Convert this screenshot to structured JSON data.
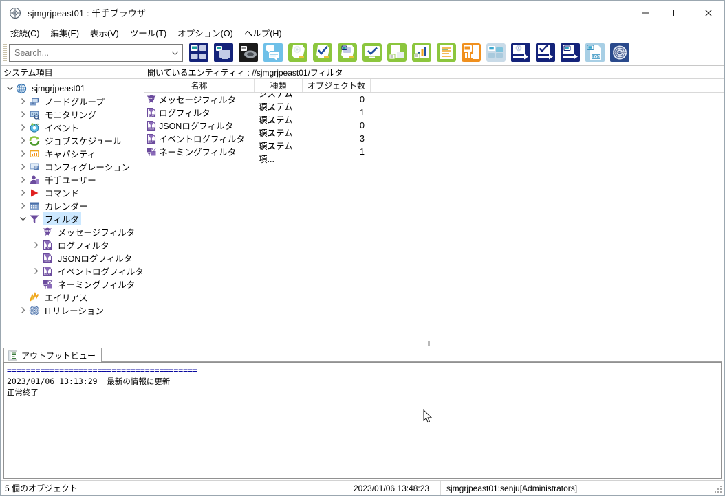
{
  "window": {
    "title": "sjmgrjpeast01 : 千手ブラウザ",
    "app_icon": "senju-app-icon",
    "controls": {
      "minimize": "—",
      "maximize": "☐",
      "close": "✕"
    }
  },
  "menubar": {
    "items": [
      {
        "label": "接続(C)",
        "name": "menu-connect"
      },
      {
        "label": "編集(E)",
        "name": "menu-edit"
      },
      {
        "label": "表示(V)",
        "name": "menu-view"
      },
      {
        "label": "ツール(T)",
        "name": "menu-tools"
      },
      {
        "label": "オプション(O)",
        "name": "menu-options"
      },
      {
        "label": "ヘルプ(H)",
        "name": "menu-help"
      }
    ]
  },
  "toolbar": {
    "search": {
      "value": "",
      "placeholder": "Search...",
      "chevron": "⌄"
    },
    "buttons": [
      {
        "name": "node-group-icon",
        "title": "ノードグループ"
      },
      {
        "name": "monitoring-icon",
        "title": "モニタリング"
      },
      {
        "name": "event-icon",
        "title": "イベント"
      },
      {
        "name": "message-filter-icon",
        "title": "メッセージフィルタ"
      },
      {
        "name": "job-schedule-icon",
        "title": "ジョブスケジュール"
      },
      {
        "name": "job-check-icon",
        "title": "ジョブ確認"
      },
      {
        "name": "job-monitor-icon",
        "title": "ジョブ監視"
      },
      {
        "name": "task-check-icon",
        "title": "タスク確認"
      },
      {
        "name": "report-doc-icon",
        "title": "レポート"
      },
      {
        "name": "capacity-chart-icon",
        "title": "キャパシティ"
      },
      {
        "name": "config-list-icon",
        "title": "コンフィグレーション"
      },
      {
        "name": "capacity-orange-icon",
        "title": "キャパシティ監視"
      },
      {
        "name": "it-relation-icon",
        "title": "ITリレーション"
      },
      {
        "name": "export-monitor-icon",
        "title": "エクスポート監視"
      },
      {
        "name": "export-check-icon",
        "title": "エクスポート確認"
      },
      {
        "name": "export-node-icon",
        "title": "エクスポートノード"
      },
      {
        "name": "log-file-icon",
        "title": "ログ"
      },
      {
        "name": "senju-target-icon",
        "title": "千手"
      }
    ]
  },
  "sidebar": {
    "header": "システム項目",
    "items": [
      {
        "label": "sjmgrjpeast01",
        "indent": 0,
        "expander": "down",
        "icon": "globe-icon",
        "selected": false,
        "name": "tree-item-root"
      },
      {
        "label": "ノードグループ",
        "indent": 1,
        "expander": "right",
        "icon": "node-group-icon",
        "selected": false,
        "name": "tree-item-node-group"
      },
      {
        "label": "モニタリング",
        "indent": 1,
        "expander": "right",
        "icon": "monitoring-icon",
        "selected": false,
        "name": "tree-item-monitoring"
      },
      {
        "label": "イベント",
        "indent": 1,
        "expander": "right",
        "icon": "event-icon",
        "selected": false,
        "name": "tree-item-event"
      },
      {
        "label": "ジョブスケジュール",
        "indent": 1,
        "expander": "right",
        "icon": "job-schedule-icon",
        "selected": false,
        "name": "tree-item-job-schedule"
      },
      {
        "label": "キャパシティ",
        "indent": 1,
        "expander": "right",
        "icon": "capacity-icon",
        "selected": false,
        "name": "tree-item-capacity"
      },
      {
        "label": "コンフィグレーション",
        "indent": 1,
        "expander": "right",
        "icon": "configuration-icon",
        "selected": false,
        "name": "tree-item-configuration"
      },
      {
        "label": "千手ユーザー",
        "indent": 1,
        "expander": "right",
        "icon": "user-icon",
        "selected": false,
        "name": "tree-item-senju-user"
      },
      {
        "label": "コマンド",
        "indent": 1,
        "expander": "right",
        "icon": "command-play-icon",
        "selected": false,
        "name": "tree-item-command"
      },
      {
        "label": "カレンダー",
        "indent": 1,
        "expander": "right",
        "icon": "calendar-icon",
        "selected": false,
        "name": "tree-item-calendar"
      },
      {
        "label": "フィルタ",
        "indent": 1,
        "expander": "down",
        "icon": "filter-icon",
        "selected": true,
        "name": "tree-item-filter"
      },
      {
        "label": "メッセージフィルタ",
        "indent": 2,
        "expander": "none",
        "icon": "message-filter-icon",
        "selected": false,
        "name": "tree-item-message-filter"
      },
      {
        "label": "ログフィルタ",
        "indent": 2,
        "expander": "right",
        "icon": "log-filter-icon",
        "selected": false,
        "name": "tree-item-log-filter"
      },
      {
        "label": "JSONログフィルタ",
        "indent": 2,
        "expander": "none",
        "icon": "json-log-filter-icon",
        "selected": false,
        "name": "tree-item-json-log-filter"
      },
      {
        "label": "イベントログフィルタ",
        "indent": 2,
        "expander": "right",
        "icon": "event-log-filter-icon",
        "selected": false,
        "name": "tree-item-event-log-filter"
      },
      {
        "label": "ネーミングフィルタ",
        "indent": 2,
        "expander": "none",
        "icon": "naming-filter-icon",
        "selected": false,
        "name": "tree-item-naming-filter"
      },
      {
        "label": "エイリアス",
        "indent": 1,
        "expander": "none",
        "icon": "alias-icon",
        "selected": false,
        "name": "tree-item-alias"
      },
      {
        "label": "ITリレーション",
        "indent": 1,
        "expander": "right",
        "icon": "it-relation-icon",
        "selected": false,
        "name": "tree-item-it-relation"
      }
    ]
  },
  "content": {
    "entity_bar": "開いているエンティティィ : //sjmgrjpeast01/フィルタ",
    "columns": [
      "名称",
      "種類",
      "オブジェクト数"
    ],
    "rows": [
      {
        "name": "メッセージフィルタ",
        "type": "システム項...",
        "count": "0",
        "icon": "message-filter-icon"
      },
      {
        "name": "ログフィルタ",
        "type": "システム項...",
        "count": "1",
        "icon": "log-filter-icon"
      },
      {
        "name": "JSONログフィルタ",
        "type": "システム項...",
        "count": "0",
        "icon": "json-log-filter-icon"
      },
      {
        "name": "イベントログフィルタ",
        "type": "システム項...",
        "count": "3",
        "icon": "event-log-filter-icon"
      },
      {
        "name": "ネーミングフィルタ",
        "type": "システム項...",
        "count": "1",
        "icon": "naming-filter-icon"
      }
    ]
  },
  "output": {
    "tab_label": "アウトプットビュー",
    "tab_icon": "output-view-icon",
    "separator_line": "========================================",
    "line1": "2023/01/06 13:13:29  最新の情報に更新",
    "line2": "正常終了"
  },
  "statusbar": {
    "objects": "5 個のオブジェクト",
    "timestamp": "2023/01/06 13:48:23",
    "user": "sjmgrjpeast01:senju[Administrators]"
  },
  "colors": {
    "accent_blue": "#1b3a8c",
    "green": "#7ac143",
    "orange": "#f08a1e",
    "light_blue": "#5bb3e4",
    "purple": "#6c4c9e",
    "selection": "#cce8ff"
  }
}
